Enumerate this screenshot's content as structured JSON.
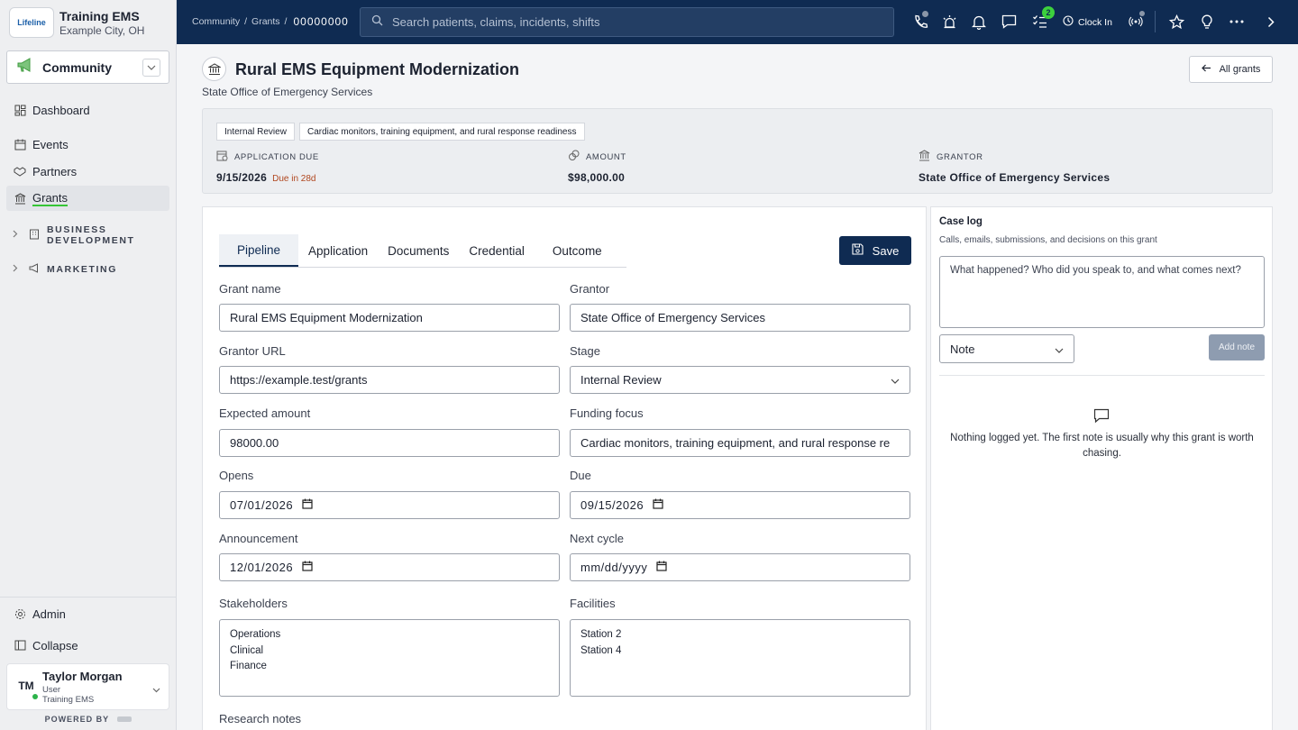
{
  "org": {
    "logo_text": "Lifeline",
    "name": "Training EMS",
    "city": "Example City, OH"
  },
  "module": {
    "name": "Community"
  },
  "nav": {
    "dashboard": "Dashboard",
    "events": "Events",
    "partners": "Partners",
    "grants": "Grants",
    "group_business": "BUSINESS DEVELOPMENT",
    "group_marketing": "MARKETING",
    "admin": "Admin",
    "collapse": "Collapse"
  },
  "user": {
    "initials": "TM",
    "name": "Taylor Morgan",
    "role": "User",
    "org": "Training EMS",
    "status_color": "#2cb34a"
  },
  "powered_by": "POWERED BY",
  "topbar": {
    "crumbs": [
      "Community",
      "Grants"
    ],
    "current_id": "00000000",
    "search_placeholder": "Search patients, claims, incidents, shifts",
    "tasks_badge": "2",
    "clock_in": "Clock In"
  },
  "page": {
    "title": "Rural EMS Equipment Modernization",
    "subtitle": "State Office of Emergency Services",
    "all_grants": "All grants"
  },
  "summary": {
    "stage_chip": "Internal Review",
    "focus_chip": "Cardiac monitors, training equipment, and rural response readiness",
    "due_label": "APPLICATION DUE",
    "due_value": "9/15/2026",
    "due_in": "Due in 28d",
    "amount_label": "AMOUNT",
    "amount_value": "$98,000.00",
    "grantor_label": "GRANTOR",
    "grantor_value": "State Office of Emergency Services"
  },
  "tabs": [
    "Pipeline",
    "Application",
    "Documents",
    "Credential",
    "Outcome"
  ],
  "save_label": "Save",
  "form": {
    "grant_name_label": "Grant name",
    "grant_name": "Rural EMS Equipment Modernization",
    "grantor_label": "Grantor",
    "grantor": "State Office of Emergency Services",
    "grantor_url_label": "Grantor URL",
    "grantor_url": "https://example.test/grants",
    "stage_label": "Stage",
    "stage": "Internal Review",
    "expected_amount_label": "Expected amount",
    "expected_amount": "98000.00",
    "funding_focus_label": "Funding focus",
    "funding_focus": "Cardiac monitors, training equipment, and rural response re",
    "opens_label": "Opens",
    "opens": "07/01/2026",
    "due_label": "Due",
    "due": "09/15/2026",
    "announcement_label": "Announcement",
    "announcement": "12/01/2026",
    "next_cycle_label": "Next cycle",
    "next_cycle": "mm/dd/yyyy",
    "stakeholders_label": "Stakeholders",
    "stakeholders": [
      "Operations",
      "Clinical",
      "Finance"
    ],
    "facilities_label": "Facilities",
    "facilities": [
      "Station 2",
      "Station 4"
    ],
    "research_notes_label": "Research notes"
  },
  "case_log": {
    "title": "Case log",
    "subtitle": "Calls, emails, submissions, and decisions on this grant",
    "placeholder": "What happened? Who did you speak to, and what comes next?",
    "type": "Note",
    "add_note": "Add note",
    "empty_message": "Nothing logged yet. The first note is usually why this grant is worth chasing."
  },
  "colors": {
    "navy": "#0f2b52",
    "accent_green": "#36c536",
    "due_warning": "#b0461e"
  }
}
